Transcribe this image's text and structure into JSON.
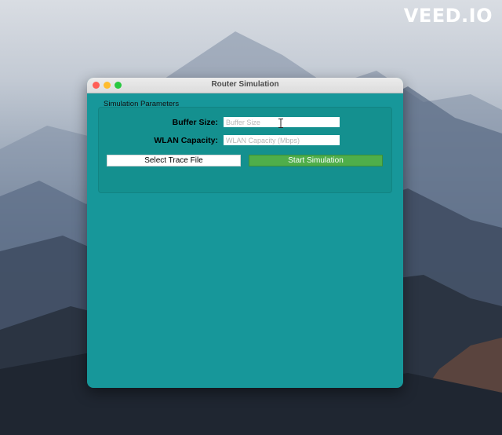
{
  "watermark": "VEED.IO",
  "window": {
    "title": "Router Simulation",
    "group_title": "Simulation Parameters",
    "fields": [
      {
        "label": "Buffer Size:",
        "value": "",
        "placeholder": "Buffer Size"
      },
      {
        "label": "WLAN Capacity:",
        "value": "",
        "placeholder": "WLAN Capacity (Mbps)"
      }
    ],
    "buttons": {
      "select_trace": "Select Trace File",
      "start": "Start Simulation"
    }
  },
  "colors": {
    "window_background": "#17979a",
    "start_button": "#4fae4a",
    "close": "#ff5f57",
    "minimize": "#febc2e",
    "maximize": "#28c840"
  }
}
